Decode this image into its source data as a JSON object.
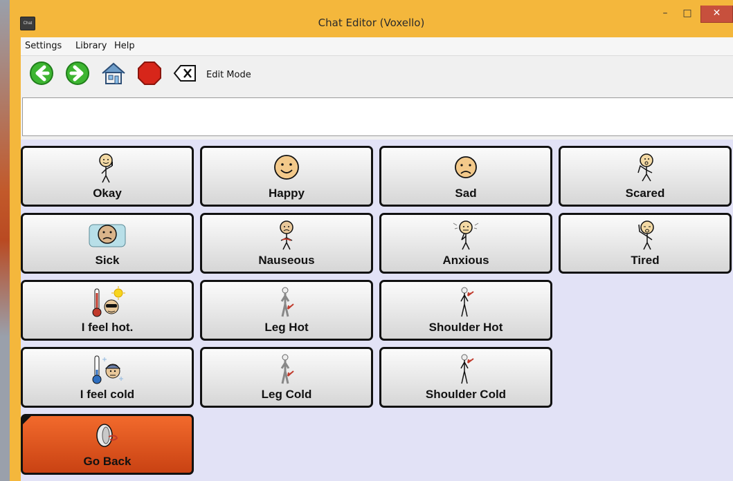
{
  "window": {
    "title": "Chat Editor (Voxello)",
    "icon_text": "Chat",
    "minimize_glyph": "–",
    "maximize_glyph": "□",
    "close_glyph": "✕"
  },
  "menu": {
    "items": [
      "Settings",
      "Library",
      "Help"
    ]
  },
  "toolbar": {
    "edit_mode_label": "Edit Mode",
    "icons": [
      "back-arrow-icon",
      "forward-arrow-icon",
      "home-icon",
      "stop-icon",
      "clear-icon"
    ]
  },
  "message_box": {
    "value": ""
  },
  "buttons": [
    {
      "label": "Okay",
      "icon": "okay-person-icon"
    },
    {
      "label": "Happy",
      "icon": "happy-face-icon"
    },
    {
      "label": "Sad",
      "icon": "sad-face-icon"
    },
    {
      "label": "Scared",
      "icon": "scared-person-icon"
    },
    {
      "label": "Sick",
      "icon": "sick-face-icon"
    },
    {
      "label": "Nauseous",
      "icon": "nauseous-person-icon"
    },
    {
      "label": "Anxious",
      "icon": "anxious-person-icon"
    },
    {
      "label": "Tired",
      "icon": "tired-person-icon"
    },
    {
      "label": "I feel hot.",
      "icon": "hot-thermometer-icon"
    },
    {
      "label": "Leg Hot",
      "icon": "leg-person-icon"
    },
    {
      "label": "Shoulder Hot",
      "icon": "shoulder-person-icon"
    },
    {
      "label": "I feel cold",
      "icon": "cold-thermometer-icon"
    },
    {
      "label": "Leg Cold",
      "icon": "leg-person-icon"
    },
    {
      "label": "Shoulder Cold",
      "icon": "shoulder-person-icon"
    },
    {
      "label": "Go Back",
      "icon": "go-back-door-icon"
    }
  ],
  "colors": {
    "window_frame": "#f4b73c",
    "grid_background": "#e2e2f6",
    "go_back_button": "#e5561f",
    "close_button": "#c7503d"
  }
}
